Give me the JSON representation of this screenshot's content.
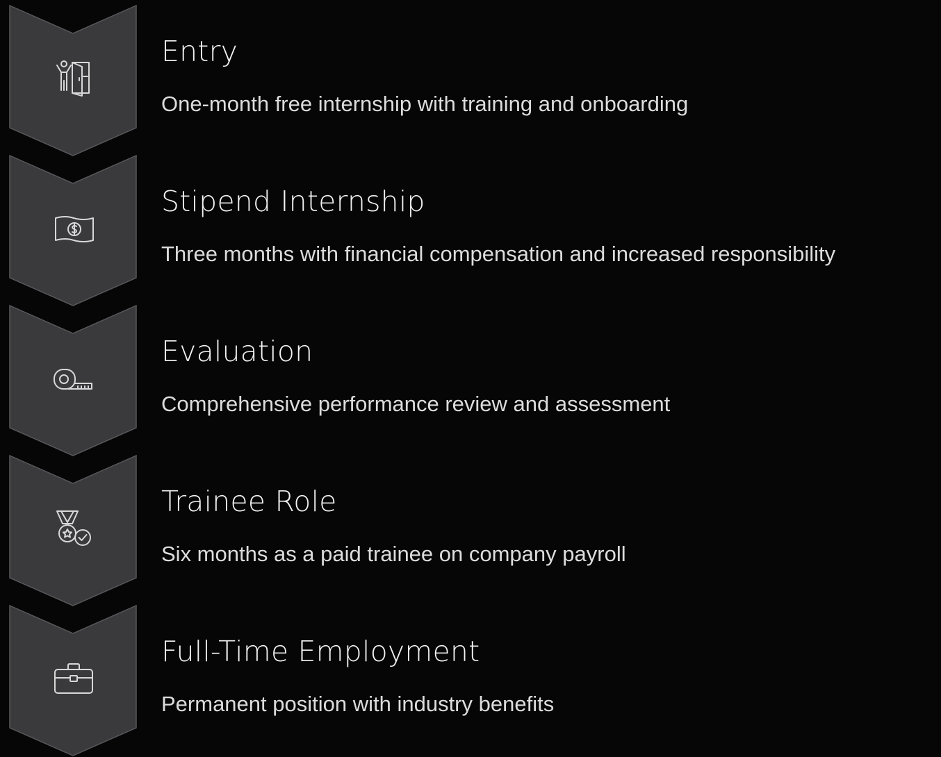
{
  "steps": [
    {
      "title": "Entry",
      "description": "One-month free internship with training and onboarding",
      "icon": "person-exit-door-icon"
    },
    {
      "title": "Stipend Internship",
      "description": "Three months with financial compensation and increased responsibility",
      "icon": "banknote-dollar-icon"
    },
    {
      "title": "Evaluation",
      "description": "Comprehensive performance review and assessment",
      "icon": "tape-measure-icon"
    },
    {
      "title": "Trainee Role",
      "description": "Six months as a paid trainee on company payroll",
      "icon": "medal-check-icon"
    },
    {
      "title": "Full-Time Employment",
      "description": "Permanent position with industry benefits",
      "icon": "briefcase-icon"
    }
  ],
  "colors": {
    "background": "#060606",
    "chevron_fill": "#3a3a3d",
    "chevron_stroke": "#58585c",
    "title_text": "#f2f2f2",
    "description_text": "#dcdcdc"
  }
}
